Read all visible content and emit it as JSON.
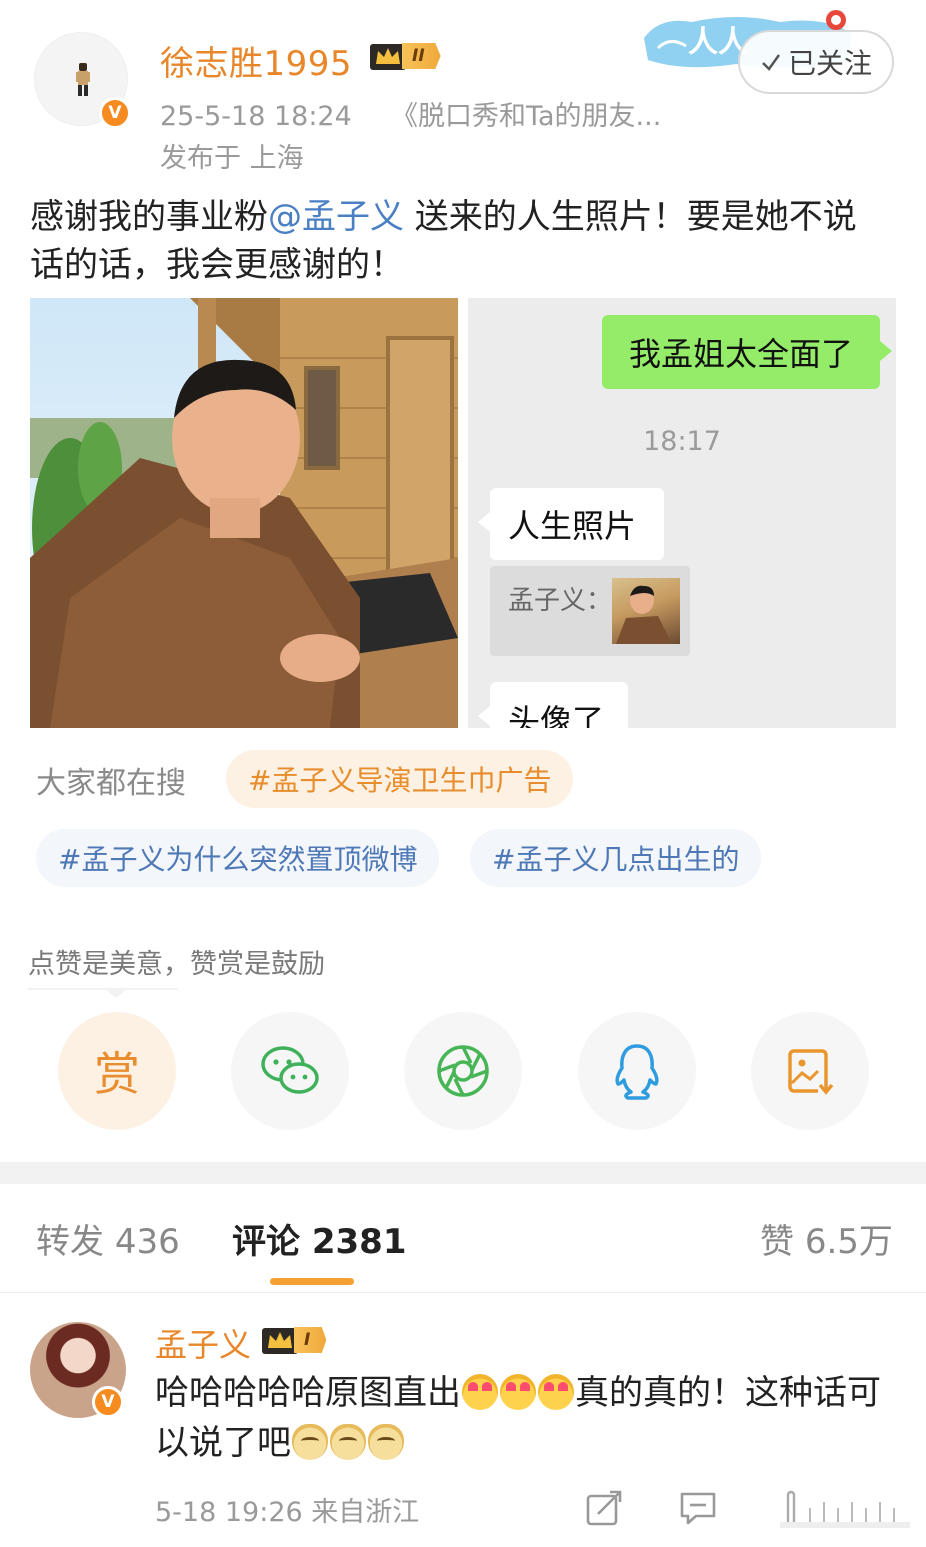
{
  "author": {
    "name": "徐志胜1995",
    "vip_level": "II",
    "verified_mark": "V",
    "time": "25-5-18 18:24",
    "source": "《脱口秀和Ta的朋友...",
    "location": "发布于 上海",
    "follow_label": "已关注"
  },
  "post": {
    "text_before": "感谢我的事业粉",
    "mention": "@孟子义",
    "text_after": " 送来的人生照片！要是她不说话的话，我会更感谢的！"
  },
  "chat_image": {
    "sent_message": "我孟姐太全面了",
    "time": "18:17",
    "received_message_1": "人生照片",
    "quote_label": "孟子义：",
    "received_message_2": "头像了"
  },
  "topics": {
    "label": "大家都在搜",
    "items": [
      "#孟子义导演卫生巾广告",
      "#孟子义为什么突然置顶微博",
      "#孟子义几点出生的"
    ]
  },
  "reward": {
    "caption": "点赞是美意，赞赏是鼓励",
    "reward_label": "赏",
    "share_icons": [
      "reward-icon",
      "wechat-icon",
      "moments-icon",
      "qq-icon",
      "save-image-icon"
    ]
  },
  "stats": {
    "repost_label": "转发",
    "repost_count": "436",
    "comment_label": "评论",
    "comment_count": "2381",
    "like_label": "赞",
    "like_count": "6.5万"
  },
  "comment": {
    "name": "孟子义",
    "vip_level": "I",
    "verified_mark": "V",
    "text_1": "哈哈哈哈哈原图直出",
    "text_2": "真的真的！这种话可以说了吧",
    "time": "5-18 19:26",
    "location": "来自浙江"
  },
  "colors": {
    "name_orange": "#e8862a",
    "link_blue": "#4a7fc4",
    "wechat_green": "#95ec69",
    "tab_indicator": "#f4a134"
  }
}
